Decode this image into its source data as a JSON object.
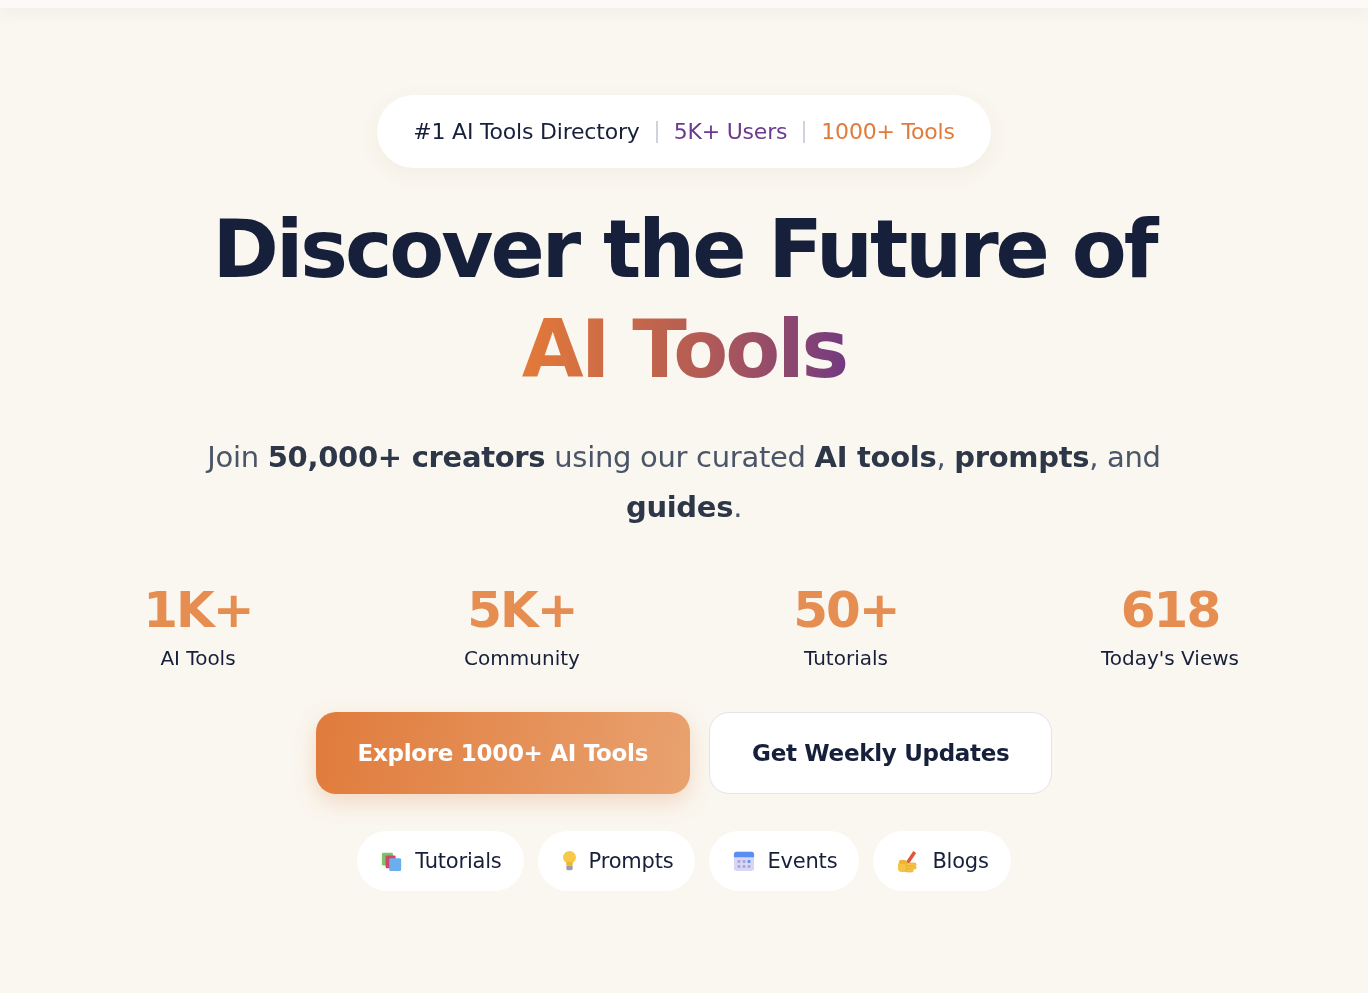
{
  "badge": {
    "items": [
      {
        "text": "#1 AI Tools Directory",
        "color": "#17203b"
      },
      {
        "text": "5K+ Users",
        "color": "#6b3a8c"
      },
      {
        "text": "1000+ Tools",
        "color": "#e07b3c"
      }
    ]
  },
  "hero": {
    "title": "Discover the Future of",
    "title_highlight": "AI Tools",
    "subtitle": "Join **50,000+ creators** using our curated **AI tools**, **prompts**, and **guides**."
  },
  "stats": [
    {
      "value": "1K+",
      "label": "AI Tools"
    },
    {
      "value": "5K+",
      "label": "Community"
    },
    {
      "value": "50+",
      "label": "Tutorials"
    },
    {
      "value": "618",
      "label": "Today's Views"
    }
  ],
  "buttons": [
    {
      "label": "Explore 1000+ AI Tools",
      "kind": "primary"
    },
    {
      "label": "Get Weekly Updates",
      "kind": "secondary"
    }
  ],
  "links": [
    {
      "label": "Tutorials"
    },
    {
      "label": "Prompts"
    },
    {
      "label": "Events"
    },
    {
      "label": "Blogs"
    }
  ]
}
